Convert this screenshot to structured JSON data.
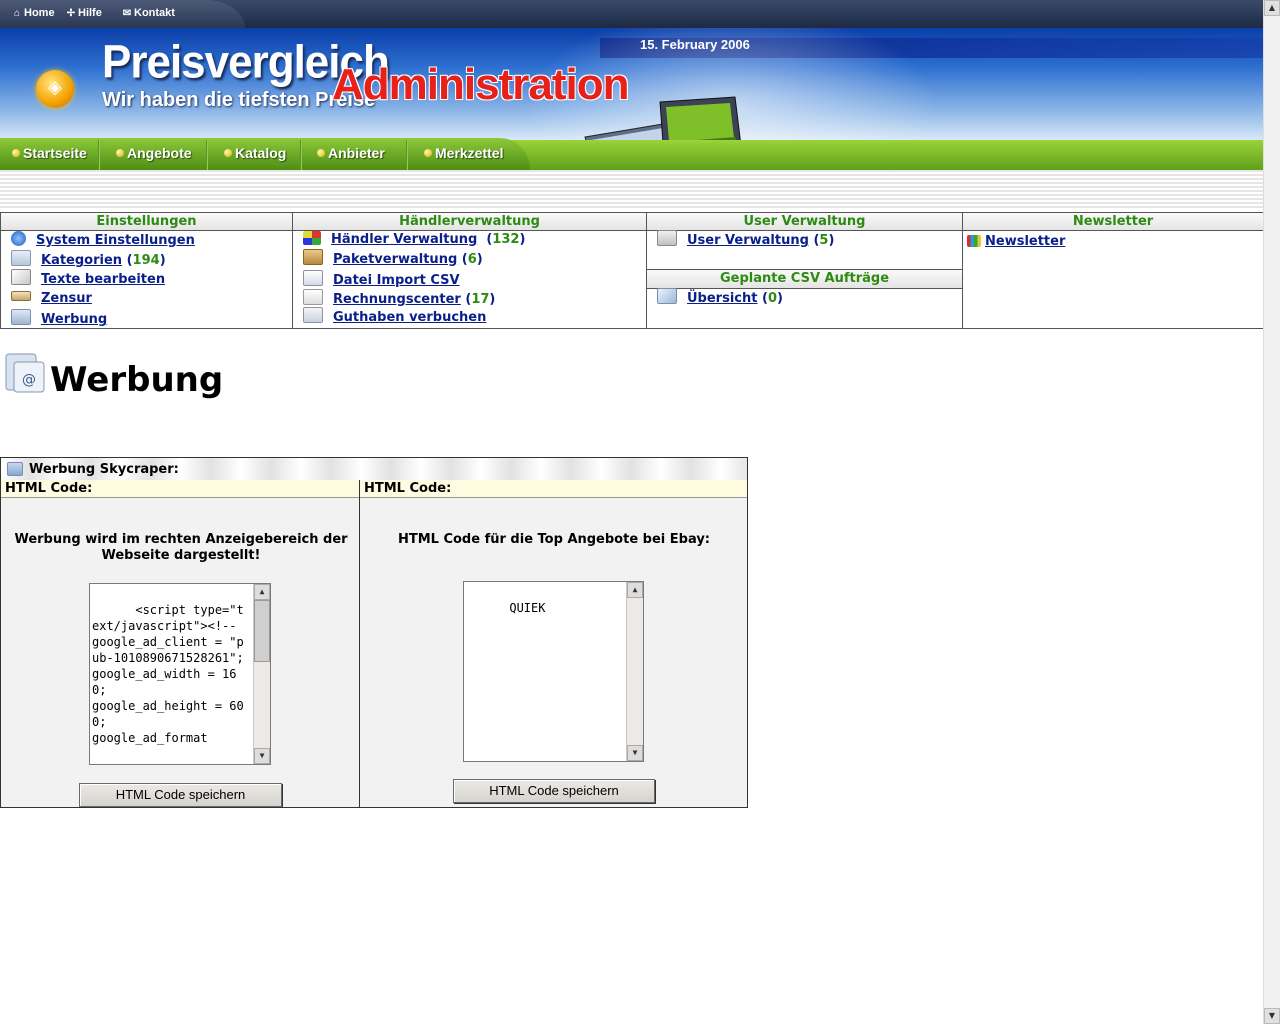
{
  "top_links": {
    "home": "Home",
    "hilfe": "Hilfe",
    "kontakt": "Kontakt"
  },
  "header": {
    "date": "15. February 2006",
    "brand_title": "Preisvergleich",
    "brand_slogan": "Wir haben die tiefsten Preise",
    "admin_word": "Administration"
  },
  "nav": {
    "items": [
      "Startseite",
      "Angebote",
      "Katalog",
      "Anbieter",
      "Merkzettel"
    ]
  },
  "menu": {
    "einstellungen": {
      "title": "Einstellungen",
      "items": [
        {
          "label": "System Einstellungen",
          "count": ""
        },
        {
          "label": "Kategorien",
          "count": "194"
        },
        {
          "label": "Texte bearbeiten",
          "count": ""
        },
        {
          "label": "Zensur",
          "count": ""
        },
        {
          "label": "Werbung",
          "count": ""
        }
      ]
    },
    "haendler": {
      "title": "Händlerverwaltung",
      "items": [
        {
          "label": "Händler Verwaltung",
          "count": "132"
        },
        {
          "label": "Paketverwaltung",
          "count": "6"
        },
        {
          "label": "Datei Import CSV",
          "count": ""
        },
        {
          "label": "Rechnungscenter",
          "count": "17"
        },
        {
          "label": "Guthaben verbuchen",
          "count": ""
        }
      ]
    },
    "user": {
      "title": "User Verwaltung",
      "items": [
        {
          "label": "User Verwaltung",
          "count": "5"
        }
      ]
    },
    "csv": {
      "title": "Geplante CSV Aufträge",
      "items": [
        {
          "label": "Übersicht",
          "count": "0"
        }
      ]
    },
    "newsletter": {
      "title": "Newsletter",
      "items": [
        {
          "label": "Newsletter",
          "count": ""
        }
      ]
    }
  },
  "page": {
    "title": "Werbung"
  },
  "panel": {
    "title": "Werbung Skycraper:",
    "left": {
      "header": "HTML Code:",
      "description": "Werbung wird im rechten Anzeigebereich der Webseite dargestellt!",
      "code": "<script type=\"text/javascript\"><!--\ngoogle_ad_client = \"pub-1010890671528261\";\ngoogle_ad_width = 160;\ngoogle_ad_height = 600;\ngoogle_ad_format",
      "button": "HTML Code speichern"
    },
    "right": {
      "header": "HTML Code:",
      "description": "HTML Code für die Top Angebote bei Ebay:",
      "code": "QUIEK",
      "button": "HTML Code speichern"
    }
  },
  "colors": {
    "link": "#0b1f8a",
    "count": "#2d8a12",
    "section_title": "#2d8a12",
    "admin_red": "#e8201a",
    "nav_green": "#5fa01a"
  }
}
